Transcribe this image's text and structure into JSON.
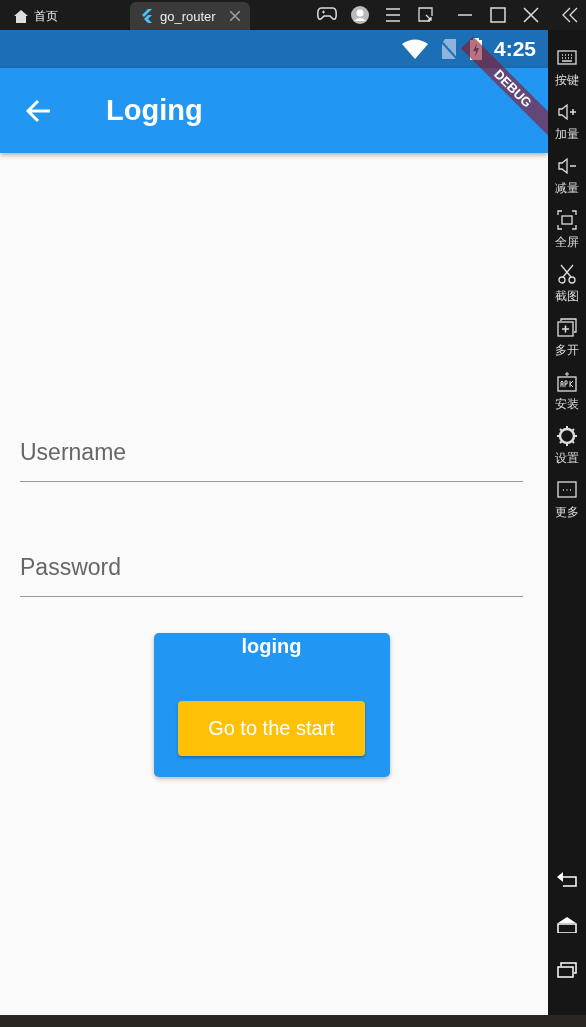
{
  "title_bar": {
    "tabs": [
      {
        "kind": "home",
        "label": "首页",
        "selected": false
      },
      {
        "kind": "app",
        "label": "go_router",
        "selected": true
      }
    ]
  },
  "status_bar": {
    "time": "4:25"
  },
  "debug_banner": "DEBUG",
  "app_bar": {
    "title": "Loging"
  },
  "fields": [
    {
      "placeholder": "Username"
    },
    {
      "placeholder": "Password"
    }
  ],
  "card": {
    "title": "loging",
    "button": "Go to the start"
  },
  "sidebar": {
    "items": [
      {
        "kind": "keyboard",
        "label": "按键"
      },
      {
        "kind": "volume-up",
        "label": "加量"
      },
      {
        "kind": "volume-down",
        "label": "减量"
      },
      {
        "kind": "fullscreen",
        "label": "全屏"
      },
      {
        "kind": "scissors",
        "label": "截图"
      },
      {
        "kind": "multi",
        "label": "多开"
      },
      {
        "kind": "apk",
        "label": "安装"
      },
      {
        "kind": "gear",
        "label": "设置"
      },
      {
        "kind": "more",
        "label": "更多"
      }
    ]
  }
}
